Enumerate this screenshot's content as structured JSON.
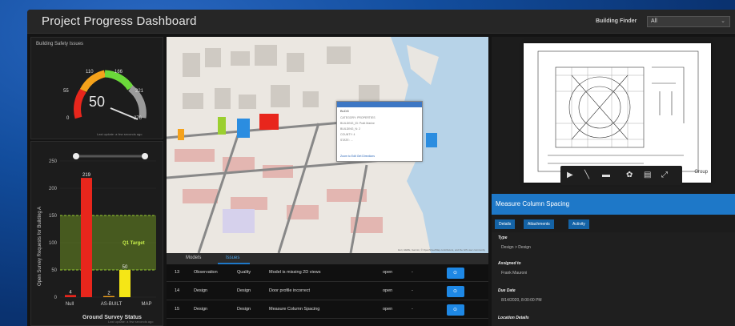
{
  "header": {
    "title": "Project Progress Dashboard",
    "finder_label": "Building Finder",
    "finder_value": "All"
  },
  "safety": {
    "title": "Building Safety Issues",
    "value": "50",
    "ticks": [
      "0",
      "55",
      "110",
      "166",
      "221",
      "276"
    ],
    "last_update": "Last update: a few seconds ago"
  },
  "survey_chart_data": {
    "type": "bar",
    "categories": [
      "Null",
      "AS-BUILT",
      "MAP"
    ],
    "values": [
      4,
      219,
      2,
      50
    ],
    "ylabel": "Open Survey Requests for Building A",
    "xlabel": "Ground Survey Status",
    "ylim": [
      0,
      250
    ],
    "target_label": "Q1 Target",
    "target_range": [
      50,
      150
    ],
    "yticks": [
      "250",
      "200",
      "150",
      "100",
      "50",
      "0"
    ],
    "last_update": "Last update: a few seconds ago"
  },
  "map": {
    "popup_title": "BLDG",
    "popup_rows": [
      "CATEGORY: PROPERTIES",
      "BUILDING_ID: Pratt Marine",
      "BUILDING_N: 2",
      "COUNTY: 4",
      "STATE: ..."
    ],
    "popup_links": "Zoom to   Edit   Get Directions",
    "attribution": "Esri, HERE, Garmin, © OpenStreetMap contributors, and the GIS user community"
  },
  "table": {
    "tabs": [
      "Models",
      "Issues"
    ],
    "rows": [
      [
        "13",
        "Observation",
        "Quality",
        "Model is missing 2D views",
        "open",
        "-"
      ],
      [
        "14",
        "Design",
        "Design",
        "Door profile incorrect",
        "open",
        "-"
      ],
      [
        "15",
        "Design",
        "Design",
        "Measure Column Spacing",
        "open",
        "-"
      ]
    ]
  },
  "drawing": {
    "group_text": "Group"
  },
  "issue": {
    "title": "Measure Column Spacing",
    "tabs": [
      "Details",
      "Attachments",
      "Activity"
    ],
    "type_label": "Type",
    "type_value": "Design > Design",
    "assigned_label": "Assigned to",
    "assigned_value": "Frank Mauroni",
    "due_label": "Due Date",
    "due_value": "8/14/2020, 8:00:00 PM",
    "location_label": "Location Details"
  },
  "colors": {
    "accent": "#1e78c8",
    "bar_red": "#e8261c",
    "bar_yellow": "#f5e616",
    "target_green": "#9acd32"
  }
}
